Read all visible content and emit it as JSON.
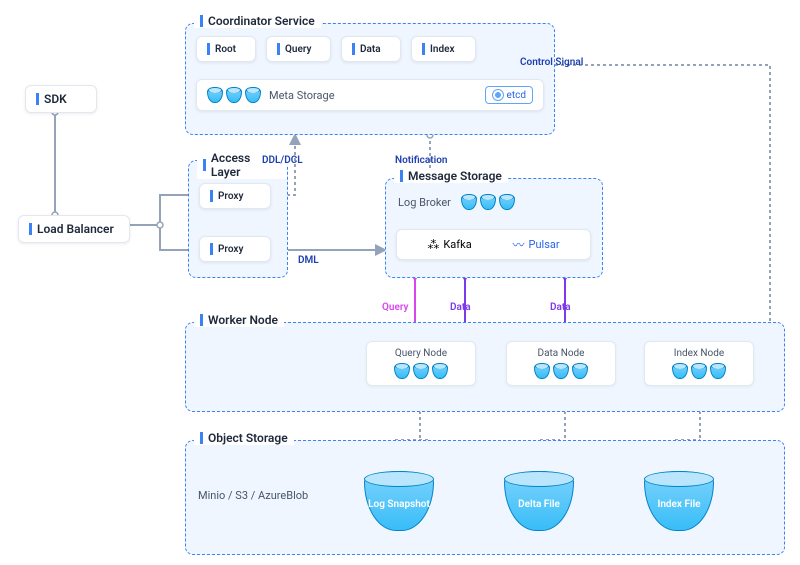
{
  "sdk": {
    "label": "SDK"
  },
  "load_balancer": {
    "label": "Load Balancer"
  },
  "coordinator": {
    "title": "Coordinator Service",
    "items": [
      "Root",
      "Query",
      "Data",
      "Index"
    ],
    "meta_storage": "Meta Storage",
    "etcd": "etcd"
  },
  "access_layer": {
    "title": "Access Layer",
    "proxy1": "Proxy",
    "proxy2": "Proxy"
  },
  "message_storage": {
    "title": "Message Storage",
    "log_broker": "Log Broker",
    "kafka": "Kafka",
    "pulsar": "Pulsar"
  },
  "worker": {
    "title": "Worker Node",
    "query_node": "Query Node",
    "data_node": "Data Node",
    "index_node": "Index Node"
  },
  "object_storage": {
    "title": "Object Storage",
    "providers": "Minio / S3 / AzureBlob",
    "log_snapshot": "Log Snapshot",
    "delta_file": "Delta File",
    "index_file": "Index File"
  },
  "edges": {
    "ddl_dcl": "DDL/DCL",
    "dml": "DML",
    "notification": "Notification",
    "control_signal": "Control Signal",
    "query": "Query",
    "data1": "Data",
    "data2": "Data"
  }
}
